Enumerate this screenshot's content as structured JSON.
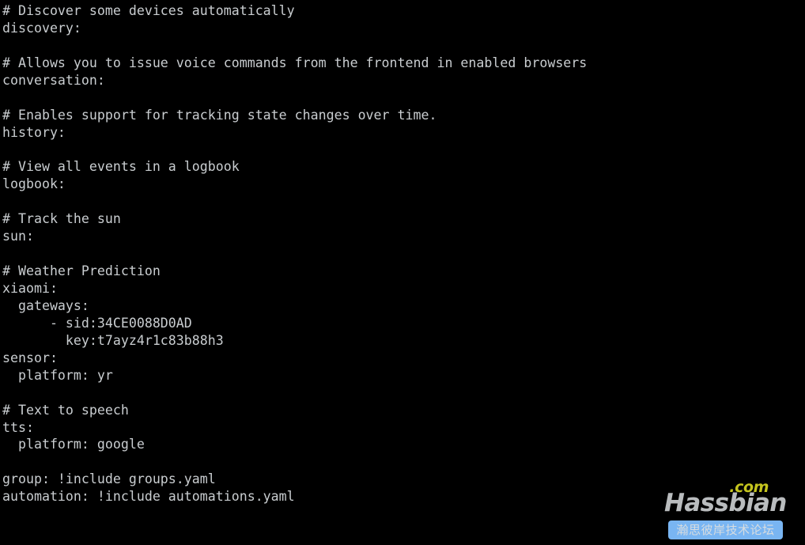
{
  "terminal": {
    "background_color": "#000000",
    "text_color": "#c9cdd0",
    "lines": [
      "# Discover some devices automatically",
      "discovery:",
      "",
      "# Allows you to issue voice commands from the frontend in enabled browsers",
      "conversation:",
      "",
      "# Enables support for tracking state changes over time.",
      "history:",
      "",
      "# View all events in a logbook",
      "logbook:",
      "",
      "# Track the sun",
      "sun:",
      "",
      "# Weather Prediction",
      "xiaomi:",
      "  gateways:",
      "      - sid:34CE0088D0AD",
      "        key:t7ayz4r1c83b88h3",
      "sensor:",
      "  platform: yr",
      "",
      "# Text to speech",
      "tts:",
      "  platform: google",
      "",
      "group: !include groups.yaml",
      "automation: !include automations.yaml"
    ]
  },
  "watermark": {
    "brand": "Hassbian",
    "tld": ".com",
    "forum_name": "瀚思彼岸技术论坛",
    "brand_color": "#b9bcbe",
    "tld_color": "#c4c41e",
    "bar_color": "#79b5f2",
    "bar_text_color": "#d8dde0"
  }
}
